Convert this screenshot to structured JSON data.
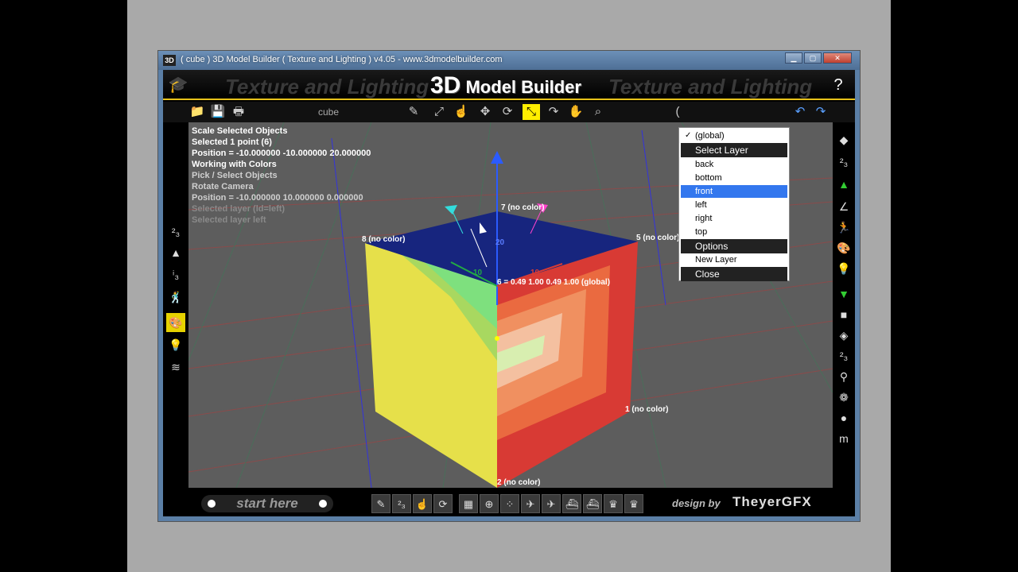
{
  "window": {
    "title": "( cube ) 3D Model Builder ( Texture and Lighting ) v4.05 - www.3dmodelbuilder.com",
    "app_icon": "3D",
    "buttons": [
      "minimize-icon",
      "maximize-icon",
      "close-icon"
    ]
  },
  "banner": {
    "watermark_left": "Texture and Lighting",
    "watermark_right": "Texture and Lighting",
    "logo_3d": "3D",
    "logo_text": "Model Builder",
    "left_icon": "graduate-icon",
    "right_icon": "help-icon"
  },
  "toolbar": {
    "document_name": "cube",
    "menu_open_prefix": "("
  },
  "info_panel": {
    "line1": "Scale Selected Objects",
    "line2": "Selected 1 point (6)",
    "line3": "Position = -10.000000 -10.000000 20.000000",
    "line4": "Working with Colors",
    "line5": "Pick / Select Objects",
    "line6": "Rotate Camera",
    "line7": "Position = -10.000000 10.000000 0.000000",
    "line8": "Selected layer (ld=left)",
    "line9": "Selected layer left"
  },
  "viewport_labels": {
    "v7": "7 (no color)",
    "v8": "8 (no color)",
    "v5": "5 (no color)",
    "v6": "6 = 0.49 1.00 0.49 1.00 (global)",
    "v1": "1 (no color)",
    "v2": "2 (no color)",
    "axis_20": "20",
    "axis_10a": "10",
    "axis_10b": "10"
  },
  "layer_menu": {
    "global_item": "(global)",
    "select_layer_header": "Select Layer",
    "items": [
      "back",
      "bottom",
      "front",
      "left",
      "right",
      "top"
    ],
    "selected": "front",
    "options_header": "Options",
    "new_layer": "New Layer",
    "close": "Close"
  },
  "bottom": {
    "start_label": "start here",
    "credit_design": "design by",
    "credit_name": "TheyerGFX"
  },
  "colors": {
    "accent_yellow": "#e8c21a",
    "menu_highlight": "#3377ee",
    "viewport_bg": "#5d5d5d"
  }
}
